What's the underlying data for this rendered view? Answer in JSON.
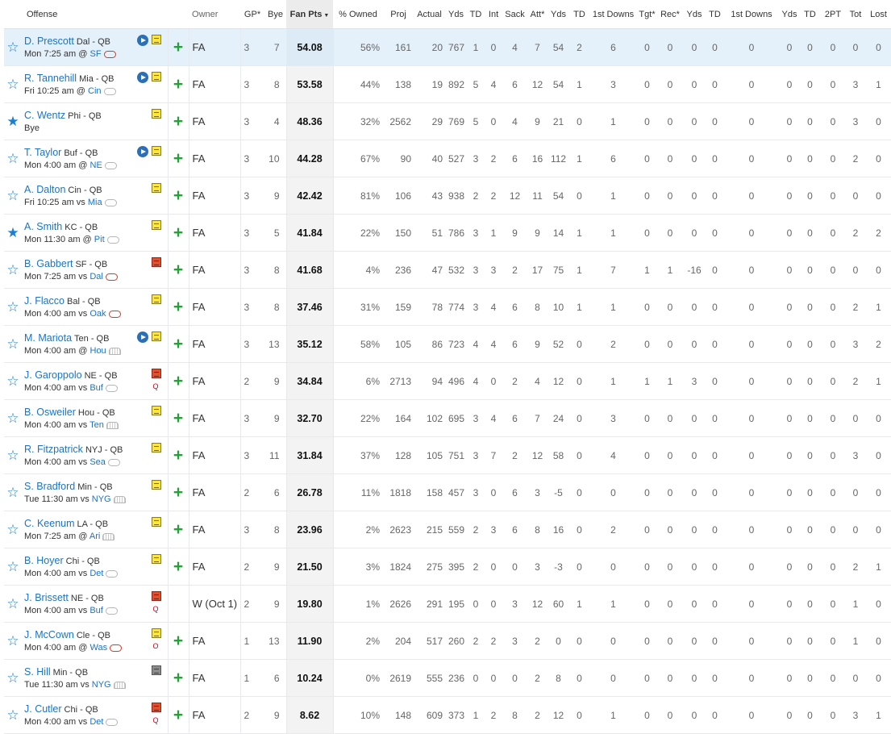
{
  "headers": [
    "Offense",
    "Owner",
    "GP*",
    "Bye",
    "Fan Pts",
    "% Owned",
    "Proj",
    "Actual",
    "Yds",
    "TD",
    "Int",
    "Sack",
    "Att*",
    "Yds",
    "TD",
    "1st Downs",
    "Tgt*",
    "Rec*",
    "Yds",
    "TD",
    "1st Downs",
    "Yds",
    "TD",
    "2PT",
    "Tot",
    "Lost"
  ],
  "sort_indicator": "▼",
  "rows": [
    {
      "name": "D. Prescott",
      "team": "Dal - QB",
      "game": "Mon 7:25 am @",
      "opp": "SF",
      "wx": "red",
      "star": "empty",
      "video": true,
      "note": "yellow",
      "inj": "",
      "owner": "FA",
      "add": true,
      "highlight": true,
      "vals": [
        "3",
        "7",
        "54.08",
        "56%",
        "161",
        "20",
        "767",
        "1",
        "0",
        "4",
        "7",
        "54",
        "2",
        "6",
        "0",
        "0",
        "0",
        "0",
        "0",
        "0",
        "0",
        "0",
        "0",
        "0"
      ]
    },
    {
      "name": "R. Tannehill",
      "team": "Mia - QB",
      "game": "Fri 10:25 am @",
      "opp": "Cin",
      "wx": "plain",
      "star": "empty",
      "video": true,
      "note": "yellow",
      "inj": "",
      "owner": "FA",
      "add": true,
      "vals": [
        "3",
        "8",
        "53.58",
        "44%",
        "138",
        "19",
        "892",
        "5",
        "4",
        "6",
        "12",
        "54",
        "1",
        "3",
        "0",
        "0",
        "0",
        "0",
        "0",
        "0",
        "0",
        "0",
        "3",
        "1"
      ]
    },
    {
      "name": "C. Wentz",
      "team": "Phi - QB",
      "game": "Bye",
      "opp": "",
      "wx": "none",
      "star": "filled",
      "video": false,
      "note": "yellow",
      "inj": "",
      "owner": "FA",
      "add": true,
      "vals": [
        "3",
        "4",
        "48.36",
        "32%",
        "2562",
        "29",
        "769",
        "5",
        "0",
        "4",
        "9",
        "21",
        "0",
        "1",
        "0",
        "0",
        "0",
        "0",
        "0",
        "0",
        "0",
        "0",
        "3",
        "0"
      ]
    },
    {
      "name": "T. Taylor",
      "team": "Buf - QB",
      "game": "Mon 4:00 am @",
      "opp": "NE",
      "wx": "plain",
      "star": "empty",
      "video": true,
      "note": "yellow",
      "inj": "",
      "owner": "FA",
      "add": true,
      "vals": [
        "3",
        "10",
        "44.28",
        "67%",
        "90",
        "40",
        "527",
        "3",
        "2",
        "6",
        "16",
        "112",
        "1",
        "6",
        "0",
        "0",
        "0",
        "0",
        "0",
        "0",
        "0",
        "0",
        "2",
        "0"
      ]
    },
    {
      "name": "A. Dalton",
      "team": "Cin - QB",
      "game": "Fri 10:25 am vs",
      "opp": "Mia",
      "wx": "plain",
      "star": "empty",
      "video": false,
      "note": "yellow",
      "inj": "",
      "owner": "FA",
      "add": true,
      "vals": [
        "3",
        "9",
        "42.42",
        "81%",
        "106",
        "43",
        "938",
        "2",
        "2",
        "12",
        "11",
        "54",
        "0",
        "1",
        "0",
        "0",
        "0",
        "0",
        "0",
        "0",
        "0",
        "0",
        "0",
        "0"
      ]
    },
    {
      "name": "A. Smith",
      "team": "KC - QB",
      "game": "Mon 11:30 am @",
      "opp": "Pit",
      "wx": "plain",
      "star": "filled",
      "video": false,
      "note": "yellow",
      "inj": "",
      "owner": "FA",
      "add": true,
      "vals": [
        "3",
        "5",
        "41.84",
        "22%",
        "150",
        "51",
        "786",
        "3",
        "1",
        "9",
        "9",
        "14",
        "1",
        "1",
        "0",
        "0",
        "0",
        "0",
        "0",
        "0",
        "0",
        "0",
        "2",
        "2"
      ]
    },
    {
      "name": "B. Gabbert",
      "team": "SF - QB",
      "game": "Mon 7:25 am vs",
      "opp": "Dal",
      "wx": "red",
      "star": "empty",
      "video": false,
      "note": "red",
      "inj": "",
      "owner": "FA",
      "add": true,
      "vals": [
        "3",
        "8",
        "41.68",
        "4%",
        "236",
        "47",
        "532",
        "3",
        "3",
        "2",
        "17",
        "75",
        "1",
        "7",
        "1",
        "1",
        "-16",
        "0",
        "0",
        "0",
        "0",
        "0",
        "0",
        "0"
      ]
    },
    {
      "name": "J. Flacco",
      "team": "Bal - QB",
      "game": "Mon 4:00 am vs",
      "opp": "Oak",
      "wx": "red",
      "star": "empty",
      "video": false,
      "note": "yellow",
      "inj": "",
      "owner": "FA",
      "add": true,
      "vals": [
        "3",
        "8",
        "37.46",
        "31%",
        "159",
        "78",
        "774",
        "3",
        "4",
        "6",
        "8",
        "10",
        "1",
        "1",
        "0",
        "0",
        "0",
        "0",
        "0",
        "0",
        "0",
        "0",
        "2",
        "1"
      ]
    },
    {
      "name": "M. Mariota",
      "team": "Ten - QB",
      "game": "Mon 4:00 am @",
      "opp": "Hou",
      "wx": "dome",
      "star": "empty",
      "video": true,
      "note": "yellow",
      "inj": "",
      "owner": "FA",
      "add": true,
      "vals": [
        "3",
        "13",
        "35.12",
        "58%",
        "105",
        "86",
        "723",
        "4",
        "4",
        "6",
        "9",
        "52",
        "0",
        "2",
        "0",
        "0",
        "0",
        "0",
        "0",
        "0",
        "0",
        "0",
        "3",
        "2"
      ]
    },
    {
      "name": "J. Garoppolo",
      "team": "NE - QB",
      "game": "Mon 4:00 am vs",
      "opp": "Buf",
      "wx": "plain",
      "star": "empty",
      "video": false,
      "note": "red",
      "inj": "Q",
      "owner": "FA",
      "add": true,
      "vals": [
        "2",
        "9",
        "34.84",
        "6%",
        "2713",
        "94",
        "496",
        "4",
        "0",
        "2",
        "4",
        "12",
        "0",
        "1",
        "1",
        "1",
        "3",
        "0",
        "0",
        "0",
        "0",
        "0",
        "2",
        "1"
      ]
    },
    {
      "name": "B. Osweiler",
      "team": "Hou - QB",
      "game": "Mon 4:00 am vs",
      "opp": "Ten",
      "wx": "dome",
      "star": "empty",
      "video": false,
      "note": "yellow",
      "inj": "",
      "owner": "FA",
      "add": true,
      "vals": [
        "3",
        "9",
        "32.70",
        "22%",
        "164",
        "102",
        "695",
        "3",
        "4",
        "6",
        "7",
        "24",
        "0",
        "3",
        "0",
        "0",
        "0",
        "0",
        "0",
        "0",
        "0",
        "0",
        "0",
        "0"
      ]
    },
    {
      "name": "R. Fitzpatrick",
      "team": "NYJ - QB",
      "game": "Mon 4:00 am vs",
      "opp": "Sea",
      "wx": "plain",
      "star": "empty",
      "video": false,
      "note": "yellow",
      "inj": "",
      "owner": "FA",
      "add": true,
      "vals": [
        "3",
        "11",
        "31.84",
        "37%",
        "128",
        "105",
        "751",
        "3",
        "7",
        "2",
        "12",
        "58",
        "0",
        "4",
        "0",
        "0",
        "0",
        "0",
        "0",
        "0",
        "0",
        "0",
        "3",
        "0"
      ]
    },
    {
      "name": "S. Bradford",
      "team": "Min - QB",
      "game": "Tue 11:30 am vs",
      "opp": "NYG",
      "wx": "dome",
      "star": "empty",
      "video": false,
      "note": "yellow",
      "inj": "",
      "owner": "FA",
      "add": true,
      "vals": [
        "2",
        "6",
        "26.78",
        "11%",
        "1818",
        "158",
        "457",
        "3",
        "0",
        "6",
        "3",
        "-5",
        "0",
        "0",
        "0",
        "0",
        "0",
        "0",
        "0",
        "0",
        "0",
        "0",
        "0",
        "0"
      ]
    },
    {
      "name": "C. Keenum",
      "team": "LA - QB",
      "game": "Mon 7:25 am @",
      "opp": "Ari",
      "wx": "dome",
      "star": "empty",
      "video": false,
      "note": "yellow",
      "inj": "",
      "owner": "FA",
      "add": true,
      "vals": [
        "3",
        "8",
        "23.96",
        "2%",
        "2623",
        "215",
        "559",
        "2",
        "3",
        "6",
        "8",
        "16",
        "0",
        "2",
        "0",
        "0",
        "0",
        "0",
        "0",
        "0",
        "0",
        "0",
        "0",
        "0"
      ]
    },
    {
      "name": "B. Hoyer",
      "team": "Chi - QB",
      "game": "Mon 4:00 am vs",
      "opp": "Det",
      "wx": "plain",
      "star": "empty",
      "video": false,
      "note": "yellow",
      "inj": "",
      "owner": "FA",
      "add": true,
      "vals": [
        "2",
        "9",
        "21.50",
        "3%",
        "1824",
        "275",
        "395",
        "2",
        "0",
        "0",
        "3",
        "-3",
        "0",
        "0",
        "0",
        "0",
        "0",
        "0",
        "0",
        "0",
        "0",
        "0",
        "2",
        "1"
      ]
    },
    {
      "name": "J. Brissett",
      "team": "NE - QB",
      "game": "Mon 4:00 am vs",
      "opp": "Buf",
      "wx": "plain",
      "star": "empty",
      "video": false,
      "note": "red",
      "inj": "Q",
      "owner": "W (Oct 1)",
      "add": false,
      "vals": [
        "2",
        "9",
        "19.80",
        "1%",
        "2626",
        "291",
        "195",
        "0",
        "0",
        "3",
        "12",
        "60",
        "1",
        "1",
        "0",
        "0",
        "0",
        "0",
        "0",
        "0",
        "0",
        "0",
        "1",
        "0"
      ]
    },
    {
      "name": "J. McCown",
      "team": "Cle - QB",
      "game": "Mon 4:00 am @",
      "opp": "Was",
      "wx": "red",
      "star": "empty",
      "video": false,
      "note": "yellow",
      "inj": "O",
      "owner": "FA",
      "add": true,
      "vals": [
        "1",
        "13",
        "11.90",
        "2%",
        "204",
        "517",
        "260",
        "2",
        "2",
        "3",
        "2",
        "0",
        "0",
        "0",
        "0",
        "0",
        "0",
        "0",
        "0",
        "0",
        "0",
        "0",
        "1",
        "0"
      ]
    },
    {
      "name": "S. Hill",
      "team": "Min - QB",
      "game": "Tue 11:30 am vs",
      "opp": "NYG",
      "wx": "dome",
      "star": "empty",
      "video": false,
      "note": "gray",
      "inj": "",
      "owner": "FA",
      "add": true,
      "vals": [
        "1",
        "6",
        "10.24",
        "0%",
        "2619",
        "555",
        "236",
        "0",
        "0",
        "0",
        "2",
        "8",
        "0",
        "0",
        "0",
        "0",
        "0",
        "0",
        "0",
        "0",
        "0",
        "0",
        "0",
        "0"
      ]
    },
    {
      "name": "J. Cutler",
      "team": "Chi - QB",
      "game": "Mon 4:00 am vs",
      "opp": "Det",
      "wx": "plain",
      "star": "empty",
      "video": false,
      "note": "red",
      "inj": "Q",
      "owner": "FA",
      "add": true,
      "vals": [
        "2",
        "9",
        "8.62",
        "10%",
        "148",
        "609",
        "373",
        "1",
        "2",
        "8",
        "2",
        "12",
        "0",
        "1",
        "0",
        "0",
        "0",
        "0",
        "0",
        "0",
        "0",
        "0",
        "3",
        "1"
      ]
    }
  ]
}
